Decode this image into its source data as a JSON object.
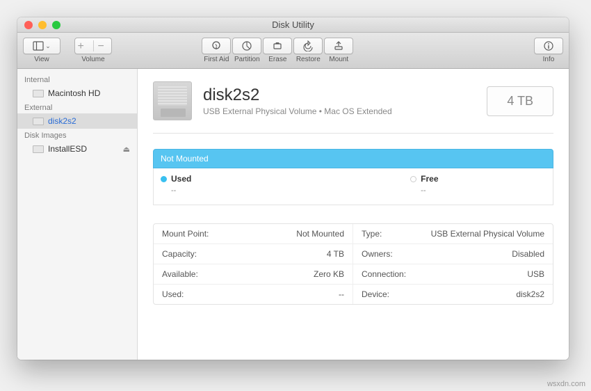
{
  "window": {
    "title": "Disk Utility"
  },
  "toolbar": {
    "view": "View",
    "volume": "Volume",
    "firstaid": "First Aid",
    "partition": "Partition",
    "erase": "Erase",
    "restore": "Restore",
    "mount": "Mount",
    "info": "Info"
  },
  "sidebar": {
    "sections": {
      "internal": "Internal",
      "external": "External",
      "diskimages": "Disk Images"
    },
    "items": {
      "macintosh_hd": "Macintosh HD",
      "disk2s2": "disk2s2",
      "installesd": "InstallESD"
    }
  },
  "volume": {
    "name": "disk2s2",
    "subtitle": "USB External Physical Volume • Mac OS Extended",
    "capacity_badge": "4 TB"
  },
  "statusbar": "Not Mounted",
  "usage": {
    "used_label": "Used",
    "used_value": "--",
    "free_label": "Free",
    "free_value": "--"
  },
  "info": {
    "mount_point_k": "Mount Point:",
    "mount_point_v": "Not Mounted",
    "type_k": "Type:",
    "type_v": "USB External Physical Volume",
    "capacity_k": "Capacity:",
    "capacity_v": "4 TB",
    "owners_k": "Owners:",
    "owners_v": "Disabled",
    "available_k": "Available:",
    "available_v": "Zero KB",
    "connection_k": "Connection:",
    "connection_v": "USB",
    "used_k": "Used:",
    "used_v": "--",
    "device_k": "Device:",
    "device_v": "disk2s2"
  },
  "watermark": "wsxdn.com"
}
